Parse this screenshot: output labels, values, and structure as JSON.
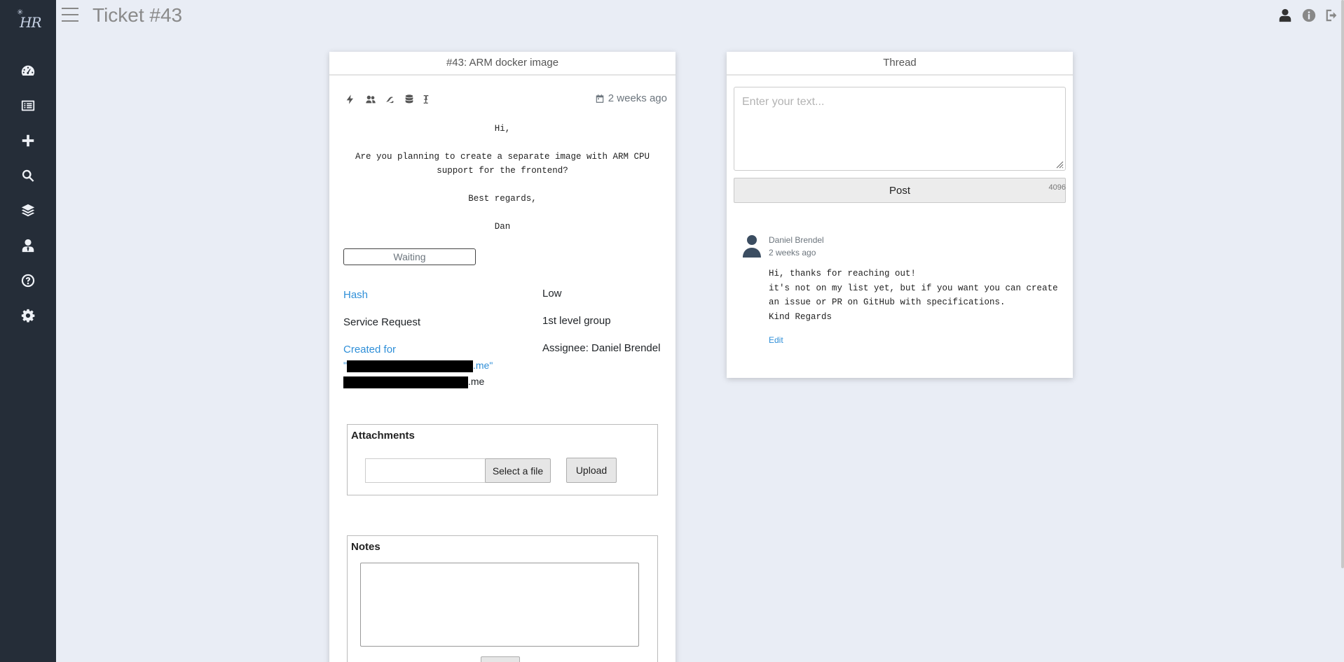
{
  "app": {
    "logo_text": "HR"
  },
  "header": {
    "title": "Ticket #43"
  },
  "sidebar": {
    "items": [
      {
        "icon": "dashboard-icon"
      },
      {
        "icon": "list-icon"
      },
      {
        "icon": "plus-icon"
      },
      {
        "icon": "search-icon"
      },
      {
        "icon": "layers-icon"
      },
      {
        "icon": "user-tie-icon"
      },
      {
        "icon": "help-icon"
      },
      {
        "icon": "gear-icon"
      }
    ]
  },
  "ticket": {
    "header": "#43: ARM docker image",
    "date": "2 weeks ago",
    "message": [
      "Hi,",
      "Are you planning to create a separate image with ARM CPU support for the frontend?",
      "Best regards,",
      "Dan"
    ],
    "status": "Waiting",
    "hash_label": "Hash",
    "priority": "Low",
    "type": "Service Request",
    "group": "1st level group",
    "created_for_label": "Created for",
    "created_for_name_prefix": "\"",
    "created_for_name_suffix": ".me\"",
    "created_for_email_suffix": ".me",
    "assignee": "Assignee: Daniel Brendel",
    "attachments": {
      "title": "Attachments",
      "select_label": "Select a file",
      "upload_label": "Upload"
    },
    "notes": {
      "title": "Notes",
      "value": ""
    }
  },
  "thread": {
    "header": "Thread",
    "input_placeholder": "Enter your text...",
    "post_label": "Post",
    "char_counter": "4096",
    "comments": [
      {
        "author": "Daniel Brendel",
        "time": "2 weeks ago",
        "lines": [
          "Hi, thanks for reaching out!",
          "it's not on my list yet, but if you want you can create an issue or PR on GitHub with specifications.",
          "Kind Regards"
        ],
        "edit_label": "Edit"
      }
    ]
  },
  "colors": {
    "sidebar_bg": "#252d38",
    "page_bg": "#e9edf5",
    "link": "#2f8fd8"
  }
}
